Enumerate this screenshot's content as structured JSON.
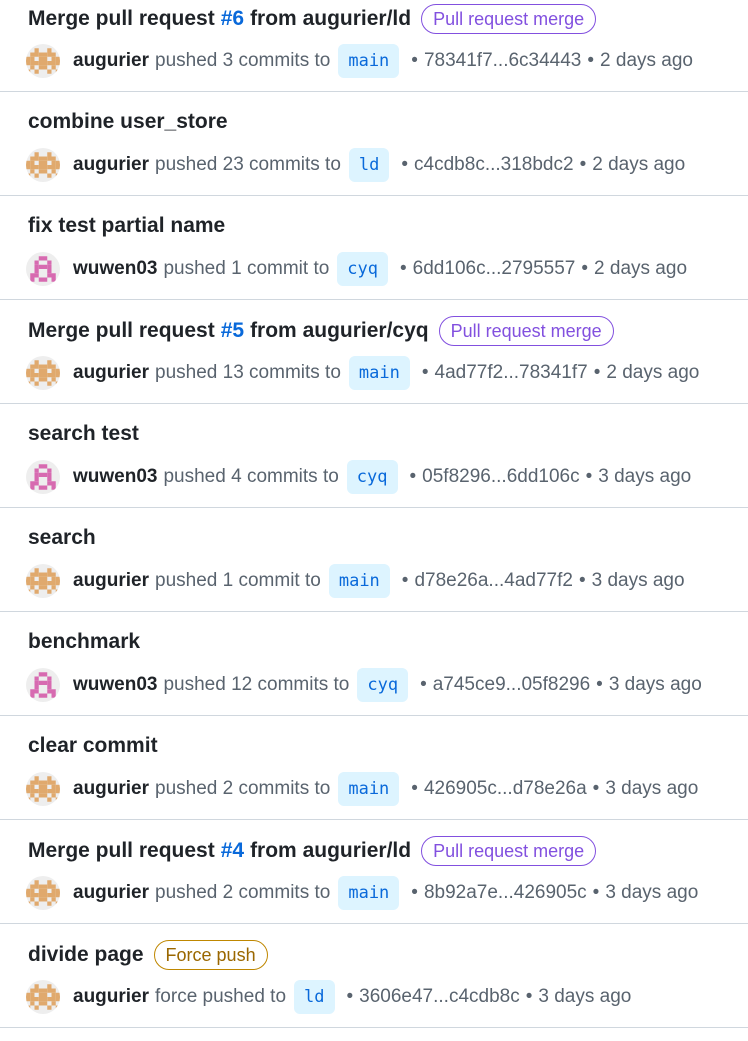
{
  "activity": [
    {
      "title_before": "Merge pull request",
      "pr_ref": "#6",
      "title_after": "from augurier/ld",
      "label": "Pull request merge",
      "label_color": "purple",
      "author": "augurier",
      "avatar_color": "#e0a96d",
      "action": "pushed 3 commits to",
      "branch": "main",
      "range": "78341f7...6c34443",
      "time": "2 days ago"
    },
    {
      "title": "combine user_store",
      "author": "augurier",
      "avatar_color": "#e0a96d",
      "action": "pushed 23 commits to",
      "branch": "ld",
      "range": "c4cdb8c...318bdc2",
      "time": "2 days ago"
    },
    {
      "title": "fix test partial name",
      "author": "wuwen03",
      "avatar_color": "#d76ab0",
      "action": "pushed 1 commit to",
      "branch": "cyq",
      "range": "6dd106c...2795557",
      "time": "2 days ago"
    },
    {
      "title_before": "Merge pull request",
      "pr_ref": "#5",
      "title_after": "from augurier/cyq",
      "label": "Pull request merge",
      "label_color": "purple",
      "author": "augurier",
      "avatar_color": "#e0a96d",
      "action": "pushed 13 commits to",
      "branch": "main",
      "range": "4ad77f2...78341f7",
      "time": "2 days ago"
    },
    {
      "title": "search test",
      "author": "wuwen03",
      "avatar_color": "#d76ab0",
      "action": "pushed 4 commits to",
      "branch": "cyq",
      "range": "05f8296...6dd106c",
      "time": "3 days ago"
    },
    {
      "title": "search",
      "author": "augurier",
      "avatar_color": "#e0a96d",
      "action": "pushed 1 commit to",
      "branch": "main",
      "range": "d78e26a...4ad77f2",
      "time": "3 days ago"
    },
    {
      "title": "benchmark",
      "author": "wuwen03",
      "avatar_color": "#d76ab0",
      "action": "pushed 12 commits to",
      "branch": "cyq",
      "range": "a745ce9...05f8296",
      "time": "3 days ago"
    },
    {
      "title": "clear commit",
      "author": "augurier",
      "avatar_color": "#e0a96d",
      "action": "pushed 2 commits to",
      "branch": "main",
      "range": "426905c...d78e26a",
      "time": "3 days ago"
    },
    {
      "title_before": "Merge pull request",
      "pr_ref": "#4",
      "title_after": "from augurier/ld",
      "label": "Pull request merge",
      "label_color": "purple",
      "author": "augurier",
      "avatar_color": "#e0a96d",
      "action": "pushed 2 commits to",
      "branch": "main",
      "range": "8b92a7e...426905c",
      "time": "3 days ago"
    },
    {
      "title": "divide page",
      "label": "Force push",
      "label_color": "brown",
      "author": "augurier",
      "avatar_color": "#e0a96d",
      "action": "force pushed to",
      "branch": "ld",
      "range": "3606e47...c4cdb8c",
      "time": "3 days ago"
    }
  ]
}
